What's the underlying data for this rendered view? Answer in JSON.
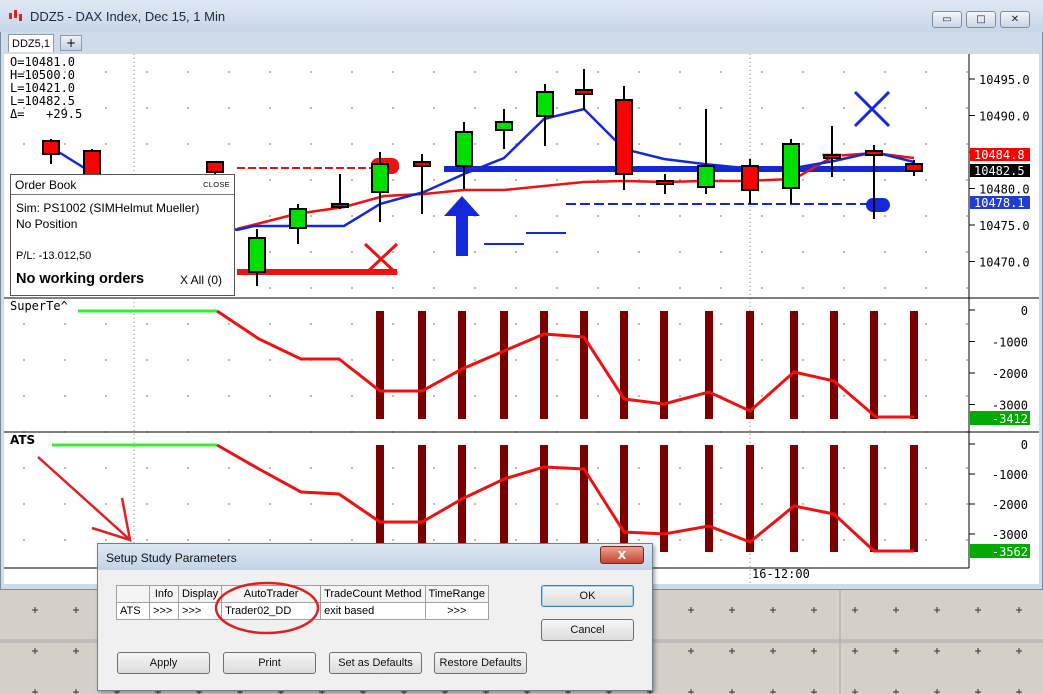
{
  "window": {
    "title": "DDZ5 - DAX Index, Dec 15, 1 Min",
    "tab_label": "DDZ5,1",
    "tab_add": "+",
    "minimize": "▭",
    "maximize": "□",
    "close": "✕"
  },
  "ohlc": {
    "o": "O=10481.0",
    "h": "H=10500.0",
    "l": "L=10421.0",
    "c": "L=10482.5",
    "delta": "Δ=   +29.5"
  },
  "price_axis": {
    "ticks": [
      "10495.0",
      "10490.0",
      "10485.0",
      "10480.0",
      "10475.0",
      "10470.0"
    ],
    "tags": [
      {
        "text": "10484.8",
        "color": "#ff0000"
      },
      {
        "text": "10482.5",
        "color": "#000000"
      },
      {
        "text": "10478.1",
        "color": "#1f3fd0"
      }
    ]
  },
  "panel2": {
    "label": "SuperTe^",
    "ticks": [
      "0",
      "-1000",
      "-2000",
      "-3000"
    ],
    "tag": "-3412",
    "tag_color": "#00aa00"
  },
  "panel3": {
    "label": "ATS",
    "ticks": [
      "0",
      "-1000",
      "-2000",
      "-3000"
    ],
    "tag": "-3562",
    "tag_color": "#00aa00"
  },
  "time_label": "16-12:00",
  "order_book": {
    "title": "Order Book",
    "close": "CLOSE",
    "account": "Sim: PS1002 (SIMHelmut Mueller)",
    "position": "No Position",
    "pl": "P/L: -13.012,50",
    "no_working": "No working orders",
    "x_all": "X All (0)"
  },
  "dialog": {
    "title": "Setup Study Parameters",
    "close": "X",
    "columns": [
      "",
      "Info",
      "Display",
      "AutoTrader",
      "TradeCount Method",
      "TimeRange"
    ],
    "row": [
      "ATS",
      ">>>",
      ">>>",
      "Trader02_DD",
      "exit based",
      ">>>"
    ],
    "buttons": {
      "ok": "OK",
      "cancel": "Cancel",
      "apply": "Apply",
      "print": "Print",
      "set_defaults": "Set as Defaults",
      "restore_defaults": "Restore Defaults"
    }
  },
  "colors": {
    "up_candle": "#00e000",
    "down_candle": "#ff0000",
    "histogram": "#7a0000",
    "blue_line": "#1428d8",
    "red_line": "#ee1111",
    "green_line": "#33ee33",
    "annotation": "#e02020"
  }
}
